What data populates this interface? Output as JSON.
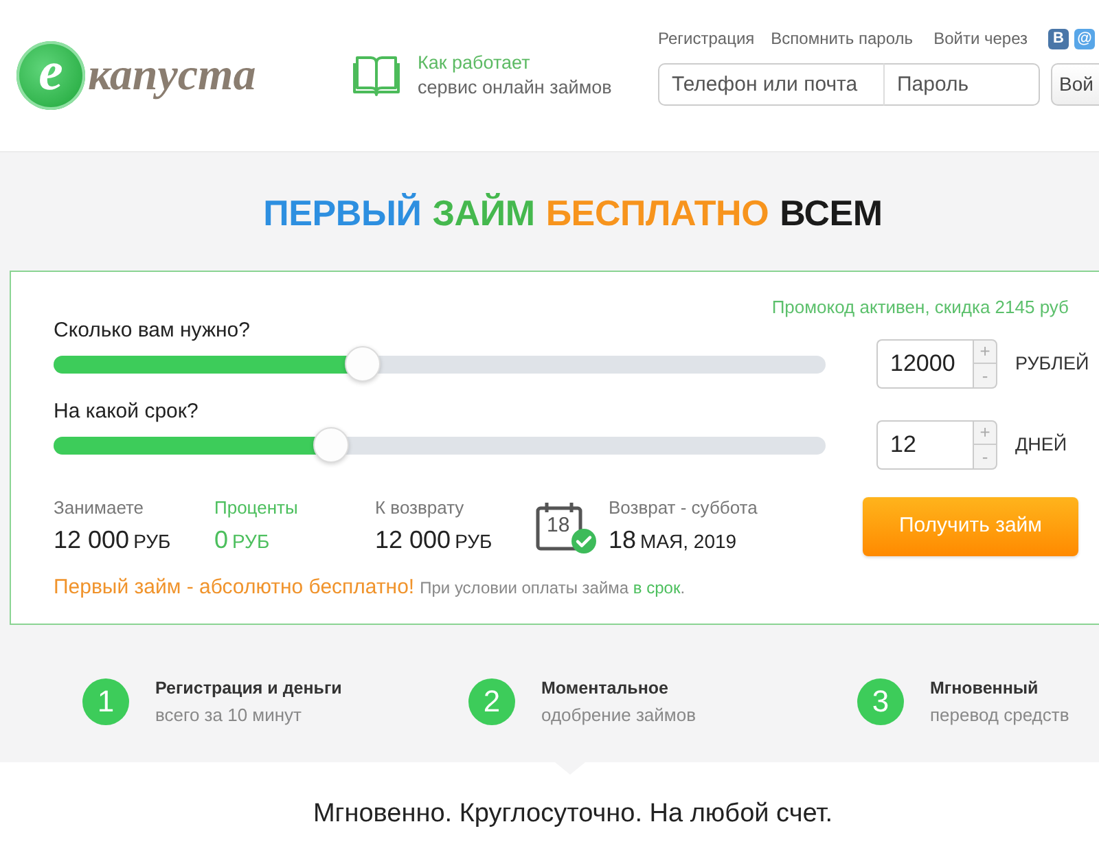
{
  "header": {
    "logo": {
      "letter": "e",
      "wordmark": "капуста"
    },
    "how_it_works": {
      "title": "Как работает",
      "subtitle": "сервис онлайн займов"
    },
    "account_links": [
      "Регистрация",
      "Вспомнить пароль"
    ],
    "social_login": {
      "label": "Войти через",
      "buttons": [
        {
          "kind": "vk",
          "label": "В"
        },
        {
          "kind": "mail",
          "label": "@"
        }
      ]
    },
    "login_form": {
      "phone": {
        "placeholder": "Телефон или почта"
      },
      "password": {
        "placeholder": "Пароль"
      },
      "submit": "Вой"
    }
  },
  "headline": [
    {
      "text": "ПЕРВЫЙ",
      "color": "#2d8fe0"
    },
    {
      "text": "ЗАЙМ",
      "color": "#45b84e"
    },
    {
      "text": "БЕСПЛАТНО",
      "color": "#f7941d"
    },
    {
      "text": "ВСЕМ",
      "color": "#1a1a1a"
    }
  ],
  "calculator": {
    "promo": "Промокод активен, скидка 2145 руб",
    "sliders": [
      {
        "label": "Сколько вам нужно?",
        "level": 0.4,
        "value": "12000",
        "increment": "+",
        "decrement": "-",
        "unit": "РУБЛЕЙ"
      },
      {
        "label": "На какой срок?",
        "level": 0.36,
        "value": "12",
        "increment": "+",
        "decrement": "-",
        "unit": "ДНЕЙ"
      }
    ],
    "summary": [
      {
        "kind": "amount",
        "label": "Занимаете",
        "value": "12 000",
        "suffix": "РУБ",
        "highlighted": false
      },
      {
        "kind": "amount",
        "label": "Проценты",
        "value": "0",
        "suffix": "РУБ",
        "highlighted": true
      },
      {
        "kind": "amount",
        "label": "К возврату",
        "value": "12 000",
        "suffix": "РУБ",
        "highlighted": false
      },
      {
        "kind": "date",
        "label": "Возврат - суббота",
        "calendar_day": "18",
        "value": "18",
        "suffix": "МАЯ, 2019",
        "highlighted": false
      }
    ],
    "submit": "Получить займ",
    "notice": {
      "headline": "Первый займ - абсолютно бесплатно!",
      "condition": "При условии оплаты займа",
      "link": "в срок",
      "end": "."
    }
  },
  "steps": [
    {
      "number": "1",
      "title": "Регистрация и деньги",
      "subtitle": "всего за 10 минут"
    },
    {
      "number": "2",
      "title": "Моментальное",
      "subtitle": "одобрение займов"
    },
    {
      "number": "3",
      "title": "Мгновенный",
      "subtitle": "перевод средств"
    }
  ],
  "tagline": "Мгновенно. Круглосуточно. На любой счет."
}
